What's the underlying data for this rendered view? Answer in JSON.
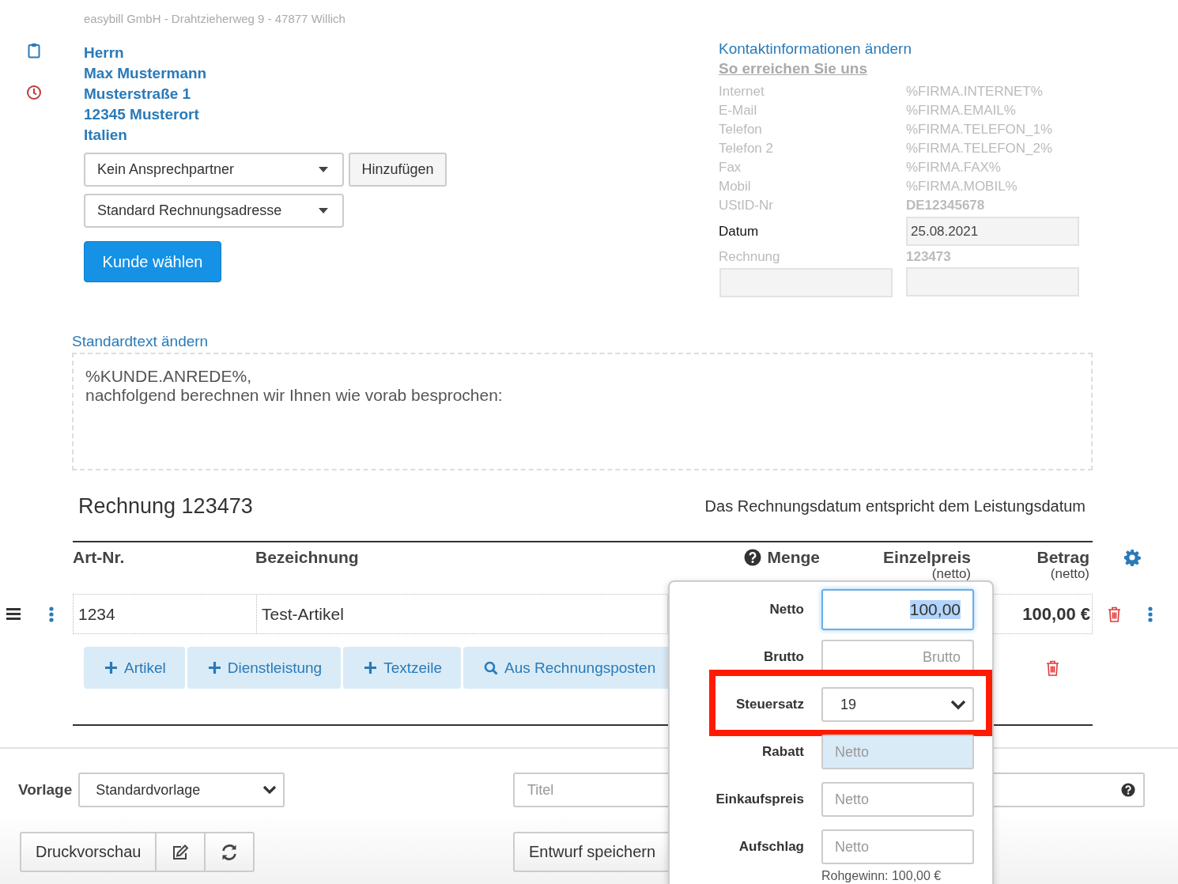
{
  "sender_line": "easybill GmbH - Drahtzieherweg 9 - 47877 Willich",
  "recipient": {
    "lines": [
      "Herrn",
      "Max Mustermann",
      "Musterstraße 1",
      "12345 Musterort",
      "Italien"
    ]
  },
  "contact_select": {
    "value": "Kein Ansprechpartner"
  },
  "add_button": "Hinzufügen",
  "address_select": {
    "value": "Standard Rechnungsadresse"
  },
  "choose_customer_button": "Kunde wählen",
  "contact_info": {
    "edit_link": "Kontaktinformationen ändern",
    "heading": "So erreichen Sie uns",
    "rows": [
      {
        "label": "Internet",
        "value": "%FIRMA.INTERNET%",
        "bold": false
      },
      {
        "label": "E-Mail",
        "value": "%FIRMA.EMAIL%",
        "bold": false
      },
      {
        "label": "Telefon",
        "value": "%FIRMA.TELEFON_1%",
        "bold": false
      },
      {
        "label": "Telefon 2",
        "value": "%FIRMA.TELEFON_2%",
        "bold": false
      },
      {
        "label": "Fax",
        "value": "%FIRMA.FAX%",
        "bold": false
      },
      {
        "label": "Mobil",
        "value": "%FIRMA.MOBIL%",
        "bold": false
      },
      {
        "label": "UStID-Nr",
        "value": "DE12345678",
        "bold": true
      }
    ],
    "date": {
      "label": "Datum",
      "value": "25.08.2021"
    },
    "invoice": {
      "label": "Rechnung",
      "value": "123473"
    }
  },
  "intro": {
    "link": "Standardtext ändern",
    "lines": [
      "%KUNDE.ANREDE%,",
      "nachfolgend berechnen wir Ihnen wie vorab besprochen:"
    ]
  },
  "invoice": {
    "title": "Rechnung 123473",
    "date_note": "Das Rechnungsdatum entspricht dem Leistungsdatum"
  },
  "table": {
    "columns": [
      {
        "label": "Art-Nr.",
        "help": false
      },
      {
        "label": "Bezeichnung",
        "help": false
      },
      {
        "label": "Menge",
        "help": true
      },
      {
        "label": "Einzelpreis",
        "sublabel": "(netto)",
        "help": false
      },
      {
        "label": "Betrag",
        "sublabel": "(netto)",
        "help": false
      }
    ],
    "rows": [
      {
        "art_nr": "1234",
        "description": "Test-Artikel",
        "amount": "100,00 €"
      }
    ]
  },
  "add_buttons": [
    {
      "label": "Artikel",
      "kind": "add"
    },
    {
      "label": "Dienstleistung",
      "kind": "add"
    },
    {
      "label": "Textzeile",
      "kind": "add"
    },
    {
      "label": "Aus Rechnungsposten",
      "kind": "search"
    }
  ],
  "footer": {
    "template_label": "Vorlage",
    "template_value": "Standardvorlage",
    "title_placeholder": "Titel",
    "preview_button": "Druckvorschau",
    "draft_button": "Entwurf speichern"
  },
  "price_popover": {
    "fields": [
      {
        "label": "Netto",
        "kind": "amount",
        "value": "100,00",
        "focused": true,
        "tinted": false,
        "marked": false
      },
      {
        "label": "Brutto",
        "kind": "amount",
        "placeholder": "Brutto",
        "focused": false,
        "tinted": false,
        "marked": false
      },
      {
        "label": "Steuersatz",
        "kind": "select",
        "value": "19",
        "focused": false,
        "tinted": false,
        "marked": true
      },
      {
        "label": "Rabatt",
        "kind": "input",
        "placeholder": "Netto",
        "focused": false,
        "tinted": true,
        "marked": false
      },
      {
        "label": "Einkaufspreis",
        "kind": "input",
        "placeholder": "Netto",
        "focused": false,
        "tinted": false,
        "marked": false
      },
      {
        "label": "Aufschlag",
        "kind": "input",
        "placeholder": "Netto",
        "focused": false,
        "tinted": false,
        "marked": false
      }
    ],
    "note": "Rohgewinn: 100,00 €"
  }
}
